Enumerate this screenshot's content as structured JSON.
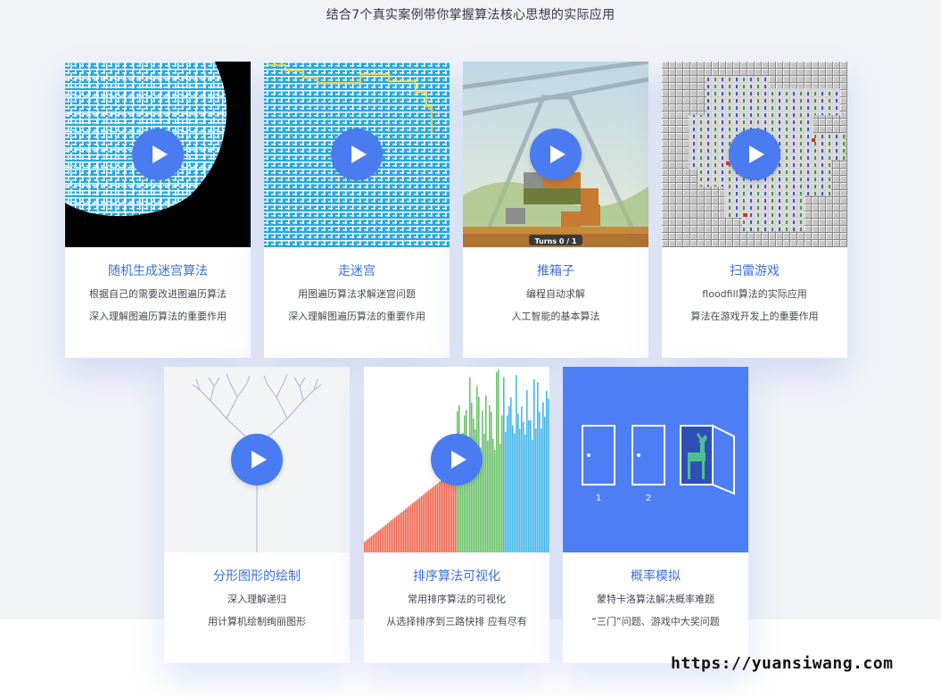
{
  "headline": "结合7个真实案例带你掌握算法核心思想的实际应用",
  "cards": [
    {
      "title": "随机生成迷宫算法",
      "desc1": "根据自己的需要改进图遍历算法",
      "desc2": "深入理解图遍历算法的重要作用"
    },
    {
      "title": "走迷宫",
      "desc1": "用图遍历算法求解迷宫问题",
      "desc2": "深入理解图遍历算法的重要作用"
    },
    {
      "title": "推箱子",
      "desc1": "编程自动求解",
      "desc2": "人工智能的基本算法"
    },
    {
      "title": "扫雷游戏",
      "desc1": "floodfill算法的实际应用",
      "desc2": "算法在游戏开发上的重要作用"
    },
    {
      "title": "分形图形的绘制",
      "desc1": "深入理解递归",
      "desc2": "用计算机绘制绚丽图形"
    },
    {
      "title": "排序算法可视化",
      "desc1": "常用排序算法的可视化",
      "desc2": "从选择排序到三路快排 应有尽有"
    },
    {
      "title": "概率模拟",
      "desc1": "蒙特卡洛算法解决概率难题",
      "desc2": "“三门”问题、游戏中大奖问题"
    }
  ],
  "sokoban_turns": "Turns 0 / 1",
  "door_labels": [
    "1",
    "2"
  ],
  "watermark": "https://yuansiwang.com",
  "colors": {
    "accent": "#4a7bf0",
    "title": "#3d6fd9",
    "maze_blue": "#29a8e0",
    "sort_red": "#ef6a55",
    "sort_green": "#6cc36a",
    "sort_blue": "#47b8ea",
    "probability_bg": "#4d7ef6",
    "goat": "#4fc08d"
  }
}
